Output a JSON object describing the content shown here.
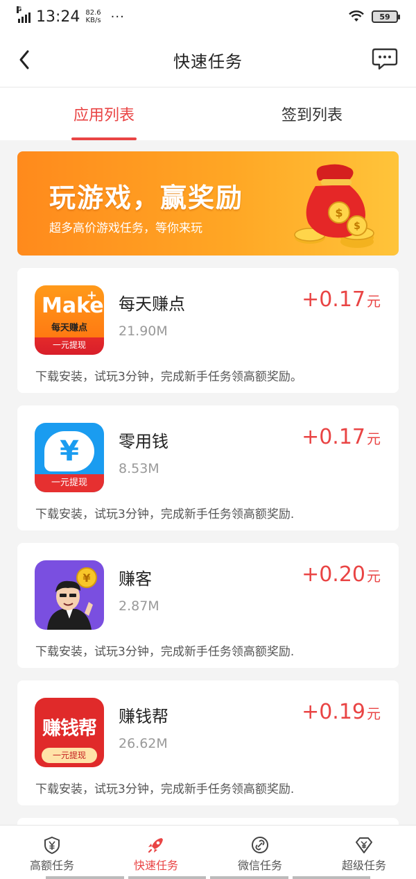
{
  "status_bar": {
    "network": "G",
    "time": "13:24",
    "speed_value": "82.6",
    "speed_unit": "KB/s",
    "more": "···",
    "battery": "59"
  },
  "header": {
    "title": "快速任务"
  },
  "tabs": [
    {
      "label": "应用列表",
      "active": true
    },
    {
      "label": "签到列表",
      "active": false
    }
  ],
  "banner": {
    "title": "玩游戏，赢奖励",
    "subtitle": "超多高价游戏任务，等你来玩"
  },
  "tasks": [
    {
      "name": "每天赚点",
      "size": "21.90M",
      "reward": "+0.17",
      "unit": "元",
      "description": "下载安装，试玩3分钟，完成新手任务领高额奖励。",
      "icon": {
        "main": "Make",
        "sub": "每天赚点",
        "tag": "一元提现",
        "plus": "+"
      }
    },
    {
      "name": "零用钱",
      "size": "8.53M",
      "reward": "+0.17",
      "unit": "元",
      "description": "下载安装，试玩3分钟，完成新手任务领高额奖励.",
      "icon": {
        "main": "¥",
        "tag": "一元提现"
      }
    },
    {
      "name": "赚客",
      "size": "2.87M",
      "reward": "+0.20",
      "unit": "元",
      "description": "下载安装，试玩3分钟，完成新手任务领高额奖励.",
      "icon": {
        "coin": "¥"
      }
    },
    {
      "name": "赚钱帮",
      "size": "26.62M",
      "reward": "+0.19",
      "unit": "元",
      "description": "下载安装，试玩3分钟，完成新手任务领高额奖励.",
      "icon": {
        "main": "赚钱帮",
        "tag": "一元提现"
      }
    }
  ],
  "bottom_nav": [
    {
      "label": "高额任务",
      "icon": "yuan-shield-icon",
      "active": false
    },
    {
      "label": "快速任务",
      "icon": "rocket-icon",
      "active": true
    },
    {
      "label": "微信任务",
      "icon": "link-circle-icon",
      "active": false
    },
    {
      "label": "超级任务",
      "icon": "diamond-yuan-icon",
      "active": false
    }
  ],
  "colors": {
    "accent": "#e94444",
    "banner_start": "#ff8a1c",
    "banner_end": "#ffc43a"
  }
}
